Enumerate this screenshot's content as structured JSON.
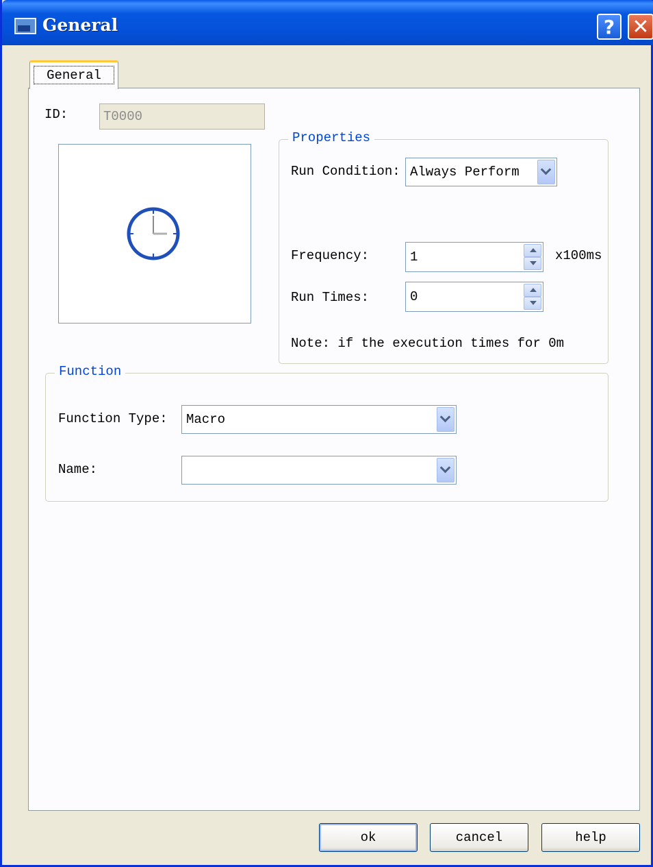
{
  "window": {
    "title": "General"
  },
  "tabs": [
    {
      "label": "General",
      "active": true
    }
  ],
  "general": {
    "id_label": "ID:",
    "id_value": "T0000"
  },
  "properties": {
    "legend": "Properties",
    "run_condition_label": "Run Condition:",
    "run_condition_value": "Always Perform",
    "frequency_label": "Frequency:",
    "frequency_value": "1",
    "frequency_unit": "x100ms",
    "run_times_label": "Run Times:",
    "run_times_value": "0",
    "note": "Note: if the execution times for 0m"
  },
  "function": {
    "legend": "Function",
    "type_label": "Function Type:",
    "type_value": "Macro",
    "name_label": "Name:",
    "name_value": ""
  },
  "buttons": {
    "ok": "ok",
    "cancel": "cancel",
    "help": "help"
  },
  "icons": {
    "title": "window-icon",
    "preview": "clock-icon",
    "help": "question-icon",
    "close": "close-icon"
  },
  "colors": {
    "titlebar": "#0550d8",
    "group_legend": "#0046d5",
    "clock": "#1f4fb8",
    "tab_highlight": "#ffc83c"
  }
}
